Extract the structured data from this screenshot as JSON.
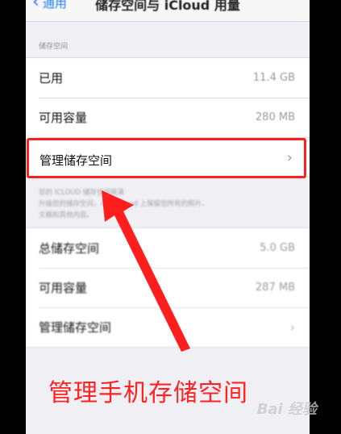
{
  "nav": {
    "back_label": "通用",
    "title": "储存空间与 iCloud 用量"
  },
  "storage_section": {
    "header": "储存空间",
    "rows": [
      {
        "label": "已用",
        "value": "11.4 GB"
      },
      {
        "label": "可用容量",
        "value": "280 MB"
      },
      {
        "label": "管理储存空间",
        "value": ""
      }
    ]
  },
  "icloud_note": {
    "line1": "您的 ICLOUD 储存空间将满",
    "line2": "升级您的储存空间，以在 iCloud 上保留您所有的照片、",
    "line3": "文稿和其他内容。"
  },
  "icloud_section": {
    "rows": [
      {
        "label": "总储存空间",
        "value": "5.0 GB"
      },
      {
        "label": "可用容量",
        "value": "287 MB"
      },
      {
        "label": "管理储存空间",
        "value": ""
      }
    ]
  },
  "annotation": {
    "caption": "管理手机存储空间",
    "highlight_color": "#ff1e1e"
  },
  "watermark": "Bai 经验"
}
